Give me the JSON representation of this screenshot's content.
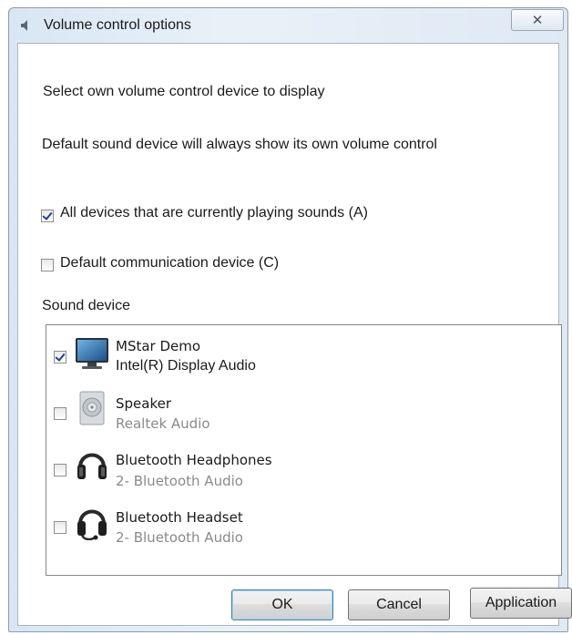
{
  "window": {
    "title": "Volume control options",
    "close_symbol": "✕",
    "title_icon": "speaker-icon"
  },
  "content": {
    "instruction": "Select own volume control device to display",
    "note": "Default sound device will always show its own volume control",
    "options": [
      {
        "label": "All devices that are currently playing sounds (A)",
        "checked": true
      },
      {
        "label": "Default communication device (C)",
        "checked": false
      }
    ],
    "sound_device_label": "Sound device"
  },
  "devices": [
    {
      "name": "MStar Demo",
      "sub": "Intel(R) Display Audio",
      "checked": true,
      "icon": "monitor-icon"
    },
    {
      "name": "Speaker",
      "sub": "Realtek Audio",
      "checked": false,
      "icon": "speaker-device-icon"
    },
    {
      "name": "Bluetooth Headphones",
      "sub": "2- Bluetooth Audio",
      "checked": false,
      "icon": "headphones-icon"
    },
    {
      "name": "Bluetooth Headset",
      "sub": "2- Bluetooth Audio",
      "checked": false,
      "icon": "headset-icon"
    }
  ],
  "buttons": {
    "ok": "OK",
    "cancel": "Cancel",
    "application": "Application"
  }
}
